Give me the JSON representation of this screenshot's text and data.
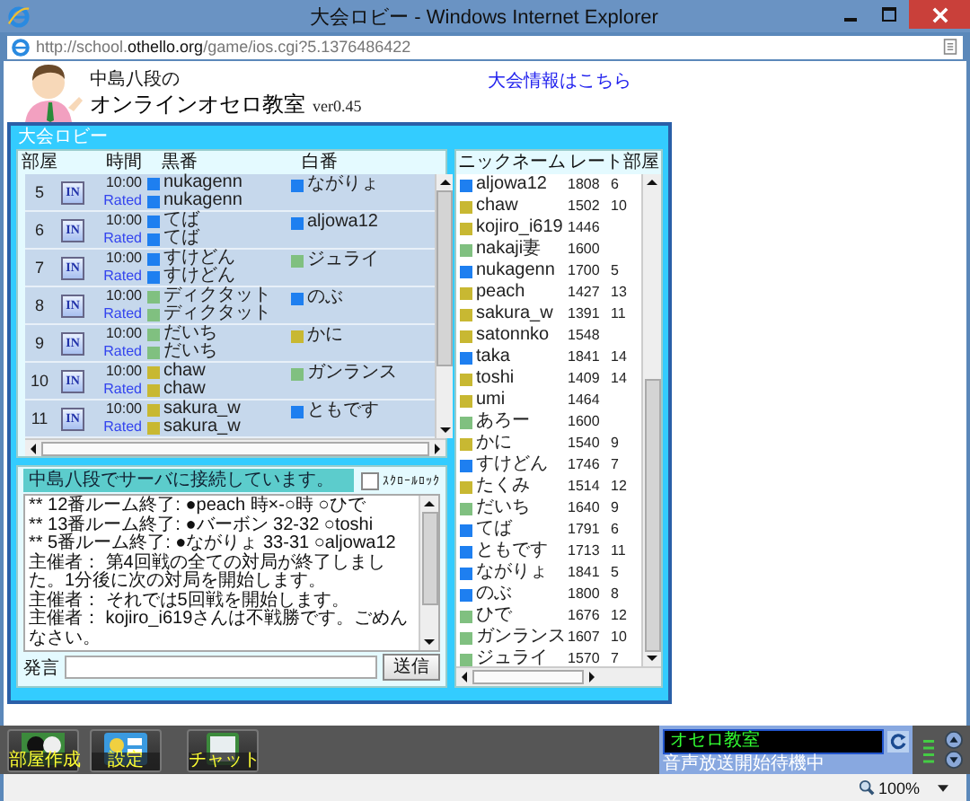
{
  "window": {
    "title": "大会ロビー - Windows Internet Explorer"
  },
  "address_bar": {
    "url": "http://school.**othello.org**/game/ios.cgi?5.1376486422"
  },
  "header": {
    "subtitle": "中島八段の",
    "title": "オンラインオセロ教室",
    "version": "ver0.45",
    "link": "大会情報はこちら"
  },
  "lobby": {
    "title": "大会ロビー",
    "columns": [
      "部屋",
      "時間",
      "黒番",
      "白番"
    ],
    "rows": [
      {
        "room": "5",
        "join": "IN",
        "time": "10:00",
        "rated": "Rated",
        "black": {
          "name": "nukagenn",
          "color": "#1e7ff0"
        },
        "white": {
          "name": "ながりょ",
          "color": "#1e7ff0"
        },
        "second": {
          "name": "nukagenn",
          "color": "#1e7ff0"
        }
      },
      {
        "room": "6",
        "join": "IN",
        "time": "10:00",
        "rated": "Rated",
        "black": {
          "name": "てば",
          "color": "#1e7ff0"
        },
        "white": {
          "name": "aljowa12",
          "color": "#1e7ff0"
        },
        "second": {
          "name": "てば",
          "color": "#1e7ff0"
        }
      },
      {
        "room": "7",
        "join": "IN",
        "time": "10:00",
        "rated": "Rated",
        "black": {
          "name": "すけどん",
          "color": "#1e7ff0"
        },
        "white": {
          "name": "ジュライ",
          "color": "#80c080"
        },
        "second": {
          "name": "すけどん",
          "color": "#1e7ff0"
        }
      },
      {
        "room": "8",
        "join": "IN",
        "time": "10:00",
        "rated": "Rated",
        "black": {
          "name": "ディクタット",
          "color": "#80c080"
        },
        "white": {
          "name": "のぶ",
          "color": "#1e7ff0"
        },
        "second": {
          "name": "ディクタット",
          "color": "#80c080"
        }
      },
      {
        "room": "9",
        "join": "IN",
        "time": "10:00",
        "rated": "Rated",
        "black": {
          "name": "だいち",
          "color": "#80c080"
        },
        "white": {
          "name": "かに",
          "color": "#c8b832"
        },
        "second": {
          "name": "だいち",
          "color": "#80c080"
        }
      },
      {
        "room": "10",
        "join": "IN",
        "time": "10:00",
        "rated": "Rated",
        "black": {
          "name": "chaw",
          "color": "#c8b832"
        },
        "white": {
          "name": "ガンランス",
          "color": "#80c080"
        },
        "second": {
          "name": "chaw",
          "color": "#c8b832"
        }
      },
      {
        "room": "11",
        "join": "IN",
        "time": "10:00",
        "rated": "Rated",
        "black": {
          "name": "sakura_w",
          "color": "#c8b832"
        },
        "white": {
          "name": "ともです",
          "color": "#1e7ff0"
        },
        "second": {
          "name": "sakura_w",
          "color": "#c8b832"
        }
      }
    ]
  },
  "players": {
    "columns": [
      "ニックネーム",
      "レート",
      "部屋"
    ],
    "rows": [
      {
        "name": "aljowa12",
        "color": "#1e7ff0",
        "rate": "1808",
        "room": "6"
      },
      {
        "name": "chaw",
        "color": "#c8b832",
        "rate": "1502",
        "room": "10"
      },
      {
        "name": "kojiro_i619",
        "color": "#c8b832",
        "rate": "1446"
      },
      {
        "name": "nakaji妻",
        "color": "#80c080",
        "rate": "1600"
      },
      {
        "name": "nukagenn",
        "color": "#1e7ff0",
        "rate": "1700",
        "room": "5"
      },
      {
        "name": "peach",
        "color": "#c8b832",
        "rate": "1427",
        "room": "13"
      },
      {
        "name": "sakura_w",
        "color": "#c8b832",
        "rate": "1391",
        "room": "11"
      },
      {
        "name": "satonnko",
        "color": "#c8b832",
        "rate": "1548"
      },
      {
        "name": "taka",
        "color": "#1e7ff0",
        "rate": "1841",
        "room": "14"
      },
      {
        "name": "toshi",
        "color": "#c8b832",
        "rate": "1409",
        "room": "14"
      },
      {
        "name": "umi",
        "color": "#c8b832",
        "rate": "1464"
      },
      {
        "name": "あろー",
        "color": "#80c080",
        "rate": "1600"
      },
      {
        "name": "かに",
        "color": "#c8b832",
        "rate": "1540",
        "room": "9"
      },
      {
        "name": "すけどん",
        "color": "#1e7ff0",
        "rate": "1746",
        "room": "7"
      },
      {
        "name": "たくみ",
        "color": "#c8b832",
        "rate": "1514",
        "room": "12"
      },
      {
        "name": "だいち",
        "color": "#80c080",
        "rate": "1640",
        "room": "9"
      },
      {
        "name": "てば",
        "color": "#1e7ff0",
        "rate": "1791",
        "room": "6"
      },
      {
        "name": "ともです",
        "color": "#1e7ff0",
        "rate": "1713",
        "room": "11"
      },
      {
        "name": "ながりょ",
        "color": "#1e7ff0",
        "rate": "1841",
        "room": "5"
      },
      {
        "name": "のぶ",
        "color": "#1e7ff0",
        "rate": "1800",
        "room": "8"
      },
      {
        "name": "ひで",
        "color": "#80c080",
        "rate": "1676",
        "room": "12"
      },
      {
        "name": "ガンランス",
        "color": "#80c080",
        "rate": "1607",
        "room": "10"
      },
      {
        "name": "ジュライ",
        "color": "#80c080",
        "rate": "1570",
        "room": "7"
      }
    ]
  },
  "chat": {
    "status": "中島八段でサーバに接続しています。",
    "scroll_lock": {
      "label": "ｽｸﾛｰﾙﾛｯｸ",
      "checked": false
    },
    "messages": [
      "** 12番ルーム終了: ●peach 時×-○時 ○ひで",
      "** 13番ルーム終了: ●バーボン 32-32 ○toshi",
      "** 5番ルーム終了: ●ながりょ 33-31 ○aljowa12",
      "主催者： 第4回戦の全ての対局が終了しました。1分後に次の対局を開始します。",
      "主催者： それでは5回戦を開始します。",
      "主催者： kojiro_i619さんは不戦勝です。ごめんなさい。"
    ],
    "input_label": "発言",
    "send": "送信"
  },
  "toolbar": {
    "buttons": [
      "部屋作成",
      "設定",
      "チャット"
    ],
    "channel": "オセロ教室",
    "status": "音声放送開始待機中"
  },
  "status_bar": {
    "zoom": "100%"
  }
}
